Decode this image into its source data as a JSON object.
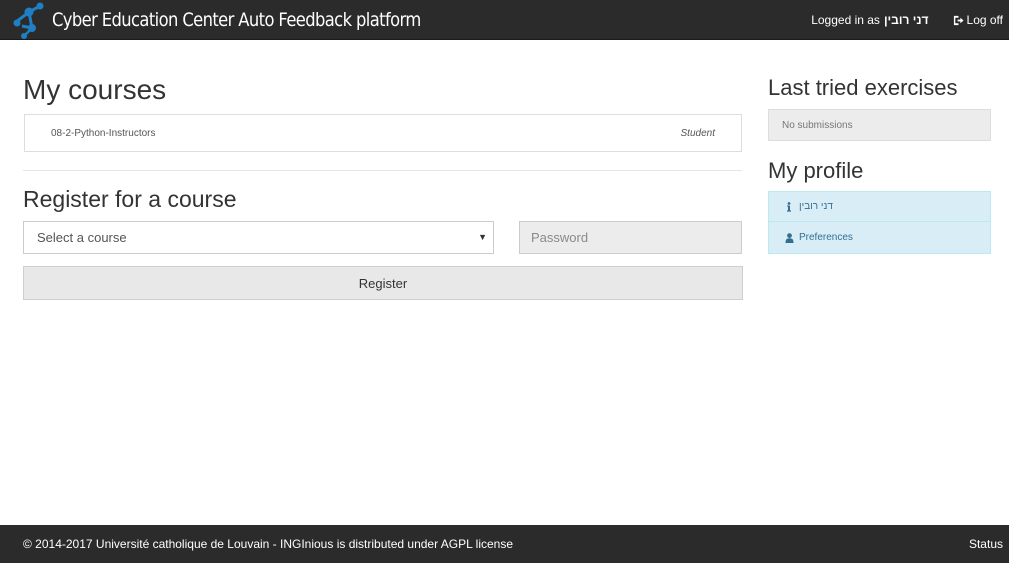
{
  "app": {
    "title": "Cyber Education Center Auto Feedback platform",
    "logo_icon": "inginious-logo-icon",
    "colors": {
      "navbar_bg": "#2b2b2b",
      "brand_blue": "#1f7fc4",
      "profile_bg": "#d9edf7",
      "profile_text": "#31708f"
    }
  },
  "header": {
    "logged_in_prefix": "Logged in as",
    "username": "דני רובין",
    "logoff_label": "Log off",
    "logoff_icon": "sign-out-icon"
  },
  "main": {
    "my_courses_title": "My courses",
    "courses": [
      {
        "name": "08-2-Python-Instructors",
        "role": "Student"
      }
    ],
    "register_title": "Register for a course",
    "course_select": {
      "selected": "Select a course"
    },
    "password_placeholder": "Password",
    "register_button": "Register"
  },
  "sidebar": {
    "last_tried_title": "Last tried exercises",
    "no_submissions": "No submissions",
    "profile_title": "My profile",
    "profile_items": [
      {
        "label": "דני רובין",
        "icon": "info-icon"
      },
      {
        "label": "Preferences",
        "icon": "user-icon"
      }
    ]
  },
  "footer": {
    "text": "© 2014-2017 Université catholique de Louvain - INGInious is distributed under AGPL license",
    "status_label": "Status"
  }
}
